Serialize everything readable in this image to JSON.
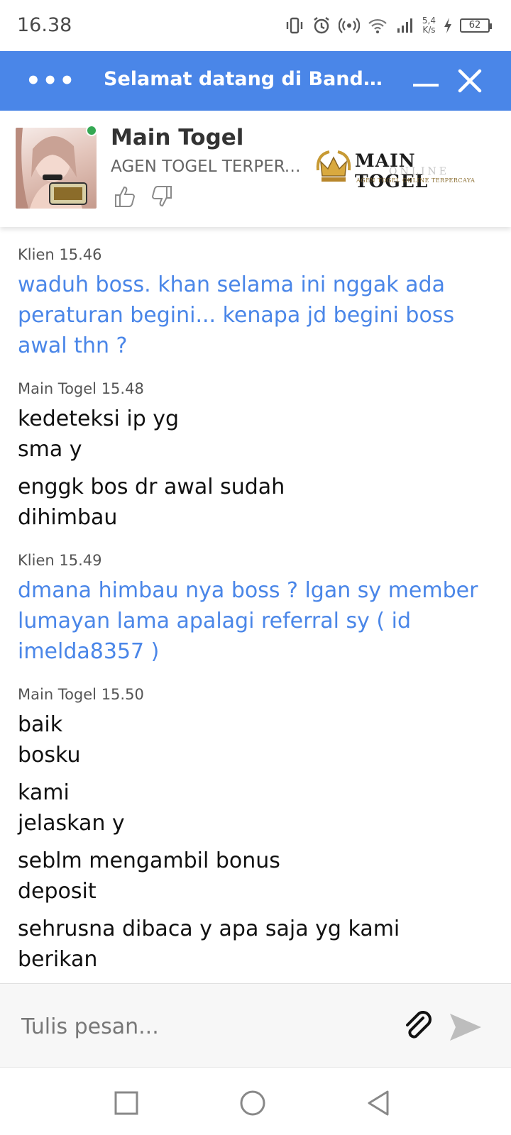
{
  "status_bar": {
    "time": "16.38",
    "net_speed_value": "5,4",
    "net_speed_unit": "K/s",
    "battery": "62"
  },
  "titlebar": {
    "menu_icon": "more-dots-icon",
    "title": "Selamat datang di Bandar Togel",
    "minimize_icon": "minimize-icon",
    "close_icon": "close-icon"
  },
  "agent": {
    "name": "Main Togel",
    "subtitle": "AGEN TOGEL TERPERCAYA",
    "status": "online",
    "logo": {
      "main": "MAIN TOGEL",
      "online": "ONLINE",
      "tag": "AGEN TOGEL ONLINE TERPERCAYA"
    }
  },
  "messages": [
    {
      "sender": "Klien",
      "time": "15.46",
      "type": "client",
      "texts": [
        "waduh boss. khan selama ini nggak ada peraturan begini... kenapa jd begini boss awal thn ?"
      ]
    },
    {
      "sender": "Main Togel",
      "time": "15.48",
      "type": "agent",
      "texts": [
        "kedeteksi ip yg\nsma y",
        "enggk bos dr awal sudah\ndihimbau"
      ]
    },
    {
      "sender": "Klien",
      "time": "15.49",
      "type": "client",
      "texts": [
        "dmana himbau nya boss ? lgan sy member lumayan lama apalagi referral sy ( id imelda8357 )"
      ]
    },
    {
      "sender": "Main Togel",
      "time": "15.50",
      "type": "agent",
      "texts": [
        "baik\nbosku",
        "kami\njelaskan y",
        "seblm mengambil bonus\ndeposit",
        "sehrusna dibaca y apa saja yg kami\nberikan"
      ]
    }
  ],
  "composer": {
    "placeholder": "Tulis pesan...",
    "attach_icon": "paperclip-icon",
    "send_icon": "send-icon"
  },
  "nav": {
    "recents_icon": "square-icon",
    "home_icon": "circle-icon",
    "back_icon": "triangle-back-icon"
  },
  "colors": {
    "accent": "#4a86e8",
    "online": "#34a853",
    "client_text": "#4a86e8",
    "agent_text": "#111111"
  }
}
